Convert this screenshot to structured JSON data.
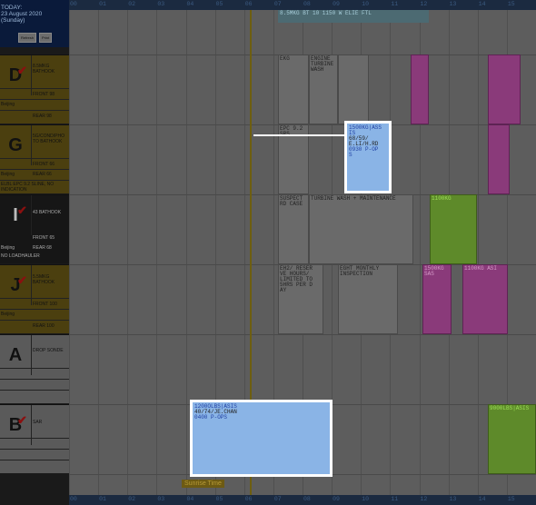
{
  "today": {
    "label": "TODAY:",
    "date": "23 August 2020",
    "weekday": "(Sunday)",
    "btn_refresh": "Refresh",
    "btn_print": "Print"
  },
  "hours": [
    "00",
    "01",
    "02",
    "03",
    "04",
    "05",
    "06",
    "07",
    "08",
    "09",
    "10",
    "11",
    "12",
    "13",
    "14",
    "15"
  ],
  "aircraft": [
    {
      "letter": "D",
      "checked": true,
      "name": "8.5MKG BATHOOK",
      "front": "FRONT 98",
      "rear": "REAR 98",
      "footer": "Beijing"
    },
    {
      "letter": "G",
      "checked": true,
      "name": "5G/COND/PHO TO BATHOOK",
      "front": "FRONT 66",
      "rear": "REAR 66",
      "footer": "Beijing",
      "note": "ELBL EPC 9.2 SLINE, NO INDICATION"
    },
    {
      "letter": "I",
      "checked": true,
      "name": "43 BATHOOK",
      "front": "FRONT 65",
      "rear": "REAR 68",
      "footer": "Beijing",
      "note": "NO LOADHAULER"
    },
    {
      "letter": "J",
      "checked": true,
      "name": "5.5MKG BATHOOK",
      "front": "FRONT 100",
      "rear": "REAR 100",
      "footer": "Beijing"
    },
    {
      "letter": "A",
      "checked": false,
      "name": "DROP SONDE"
    },
    {
      "letter": "B",
      "checked": true,
      "name": "SAR"
    }
  ],
  "blocks": {
    "top_strip": "8.5MKG BT  10 1150 W ELIE FTL",
    "d_ekg": "EKG",
    "d_engine": "ENGINE TURBINE WASH",
    "g_epc": "EPC 9.2 SRS",
    "g_selected_l1": "1500KG|ASS IS",
    "g_selected_l2": "68/59/",
    "g_selected_l3": "E.LI/H.RD",
    "g_selected_l4": "0930 P-OP",
    "g_selected_l5": "S",
    "i_suspect": "SUSPECT RD CASE",
    "i_turbine": "TURBINE WASH + MAINTENANCE",
    "i_green": "1100KG",
    "j_eh": "EH2/ RESER VE HOURS/ LIMITED TO 5HRS PER D AY",
    "j_eght": "EGHT MONTHLY INSPECTION",
    "j_pink1": "1500KG SAS",
    "j_pink2": "1100KG ASI",
    "b_selected_l1": "1200OLBS|ASIS",
    "b_selected_l2": "40/74/JE.CHAN",
    "b_selected_l3": "0400 P-OPS",
    "b_green": "9000LBS|ASIS"
  },
  "sunrise_label": "Sunrise Time"
}
